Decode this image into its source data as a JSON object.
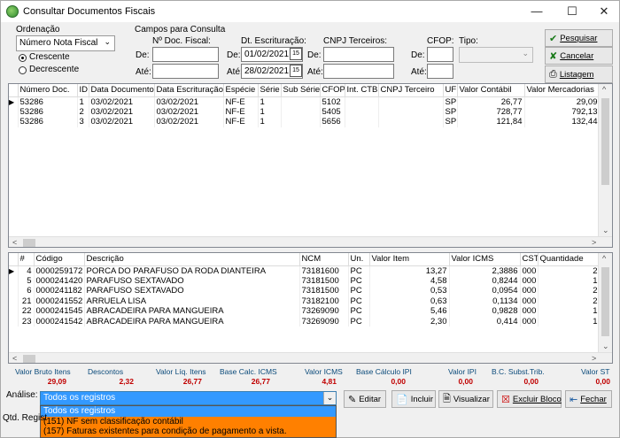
{
  "window": {
    "title": "Consultar Documentos Fiscais",
    "minimize": "—",
    "maximize": "☐",
    "close": "✕"
  },
  "ordenacao": {
    "label": "Ordenação",
    "selected": "Número Nota Fiscal",
    "crescente": "Crescente",
    "decrescente": "Decrescente"
  },
  "campos": {
    "group_label": "Campos para Consulta",
    "nro_doc_label": "Nº Doc. Fiscal:",
    "dt_escrit_label": "Dt. Escrituração:",
    "cnpj_label": "CNPJ Terceiros:",
    "cfop_label": "CFOP:",
    "tipo_label": "Tipo:",
    "de": "De:",
    "ate": "Até:",
    "dt_de": "01/02/2021",
    "dt_ate": "28/02/2021"
  },
  "buttons": {
    "pesquisar": "Pesquisar",
    "cancelar": "Cancelar",
    "listagem": "Listagem",
    "editar": "Editar",
    "incluir": "Incluir",
    "visualizar": "Visualizar",
    "excluir_bloco": "Excluir Bloco",
    "fechar": "Fechar"
  },
  "doc_grid": {
    "columns": [
      "Número Doc.",
      "ID",
      "Data Documento",
      "Data Escrituração",
      "Espécie",
      "Série",
      "Sub Série",
      "CFOP",
      "Int. CTB",
      "CNPJ Terceiro",
      "UF",
      "Valor Contábil",
      "Valor Mercadorias"
    ],
    "rows": [
      [
        "53286",
        "1",
        "03/02/2021",
        "03/02/2021",
        "NF-E",
        "1",
        "",
        "5102",
        "",
        "",
        "SP",
        "26,77",
        "29,09"
      ],
      [
        "53286",
        "2",
        "03/02/2021",
        "03/02/2021",
        "NF-E",
        "1",
        "",
        "5405",
        "",
        "",
        "SP",
        "728,77",
        "792,13"
      ],
      [
        "53286",
        "3",
        "03/02/2021",
        "03/02/2021",
        "NF-E",
        "1",
        "",
        "5656",
        "",
        "",
        "SP",
        "121,84",
        "132,44"
      ]
    ]
  },
  "item_grid": {
    "columns": [
      "#",
      "Código",
      "Descrição",
      "NCM",
      "Un.",
      "Valor Item",
      "Valor ICMS",
      "CST",
      "Quantidade"
    ],
    "rows": [
      [
        "4",
        "0000259172",
        "PORCA DO PARAFUSO DA RODA DIANTEIRA",
        "73181600",
        "PC",
        "13,27",
        "2,3886",
        "000",
        "2"
      ],
      [
        "5",
        "0000241420",
        "PARAFUSO SEXTAVADO",
        "73181500",
        "PC",
        "4,58",
        "0,8244",
        "000",
        "1"
      ],
      [
        "6",
        "0000241182",
        "PARAFUSO SEXTAVADO",
        "73181500",
        "PC",
        "0,53",
        "0,0954",
        "000",
        "2"
      ],
      [
        "21",
        "0000241552",
        "ARRUELA LISA",
        "73182100",
        "PC",
        "0,63",
        "0,1134",
        "000",
        "2"
      ],
      [
        "22",
        "0000241545",
        "ABRACADEIRA PARA MANGUEIRA",
        "73269090",
        "PC",
        "5,46",
        "0,9828",
        "000",
        "1"
      ],
      [
        "23",
        "0000241542",
        "ABRACADEIRA PARA MANGUEIRA",
        "73269090",
        "PC",
        "2,30",
        "0,414",
        "000",
        "1"
      ]
    ]
  },
  "totals": [
    {
      "label": "Valor Bruto Itens",
      "value": "29,09"
    },
    {
      "label": "Descontos",
      "value": "2,32"
    },
    {
      "label": "Valor Líq. Itens",
      "value": "26,77"
    },
    {
      "label": "Base Calc. ICMS",
      "value": "26,77"
    },
    {
      "label": "Valor ICMS",
      "value": "4,81"
    },
    {
      "label": "Base Cálculo IPI",
      "value": "0,00"
    },
    {
      "label": "Valor IPI",
      "value": "0,00"
    },
    {
      "label": "B.C. Subst.Trib.",
      "value": "0,00"
    },
    {
      "label": "Valor ST",
      "value": "0,00"
    }
  ],
  "analise": {
    "label": "Análise:",
    "selected": "Todos os registros",
    "options": [
      "Todos os registros",
      "(151) NF sem classificação contábil",
      "(157) Faturas existentes para condição de pagamento a vista."
    ]
  },
  "status": {
    "qtd_label": "Qtd. Regist"
  },
  "colors": {
    "total_label": "#0a4a7a",
    "total_value": "#c00000",
    "dropdown_bg": "#ff8000",
    "dropdown_selected": "#3399ff"
  }
}
